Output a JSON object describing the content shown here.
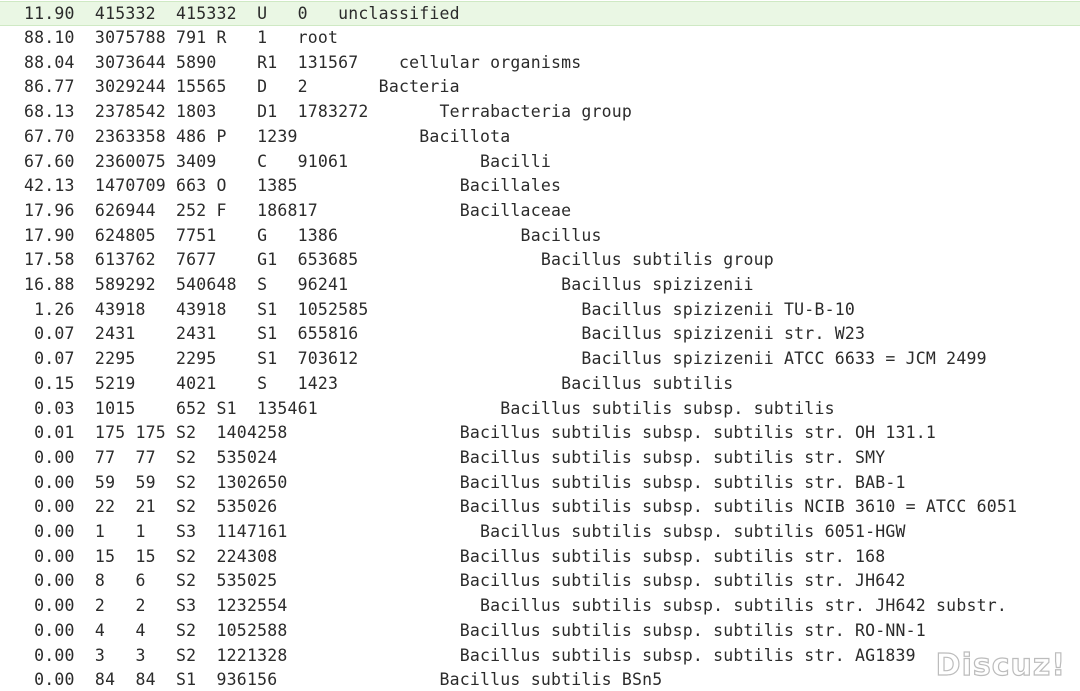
{
  "editor": {
    "lines": [
      "11.90  415332  415332  U   0   unclassified",
      "88.10  3075788 791 R   1   root",
      "88.04  3073644 5890    R1  131567    cellular organisms",
      "86.77  3029244 15565   D   2       Bacteria",
      "68.13  2378542 1803    D1  1783272       Terrabacteria group",
      "67.70  2363358 486 P   1239            Bacillota",
      "67.60  2360075 3409    C   91061             Bacilli",
      "42.13  1470709 663 O   1385                Bacillales",
      "17.96  626944  252 F   186817              Bacillaceae",
      "17.90  624805  7751    G   1386                  Bacillus",
      "17.58  613762  7677    G1  653685                  Bacillus subtilis group",
      "16.88  589292  540648  S   96241                     Bacillus spizizenii",
      " 1.26  43918   43918   S1  1052585                     Bacillus spizizenii TU-B-10",
      " 0.07  2431    2431    S1  655816                      Bacillus spizizenii str. W23",
      " 0.07  2295    2295    S1  703612                      Bacillus spizizenii ATCC 6633 = JCM 2499",
      " 0.15  5219    4021    S   1423                      Bacillus subtilis",
      " 0.03  1015    652 S1  135461                  Bacillus subtilis subsp. subtilis",
      " 0.01  175 175 S2  1404258                 Bacillus subtilis subsp. subtilis str. OH 131.1",
      " 0.00  77  77  S2  535024                  Bacillus subtilis subsp. subtilis str. SMY",
      " 0.00  59  59  S2  1302650                 Bacillus subtilis subsp. subtilis str. BAB-1",
      " 0.00  22  21  S2  535026                  Bacillus subtilis subsp. subtilis NCIB 3610 = ATCC 6051",
      " 0.00  1   1   S3  1147161                   Bacillus subtilis subsp. subtilis 6051-HGW",
      " 0.00  15  15  S2  224308                  Bacillus subtilis subsp. subtilis str. 168",
      " 0.00  8   6   S2  535025                  Bacillus subtilis subsp. subtilis str. JH642",
      " 0.00  2   2   S3  1232554                   Bacillus subtilis subsp. subtilis str. JH642 substr.",
      " 0.00  4   4   S2  1052588                 Bacillus subtilis subsp. subtilis str. RO-NN-1",
      " 0.00  3   3   S2  1221328                 Bacillus subtilis subsp. subtilis str. AG1839",
      " 0.00  84  84  S1  936156                Bacillus subtilis BSn5"
    ]
  },
  "watermark": "Discuz!",
  "colors": {
    "current_line_bg": "#eaf7e4",
    "text": "#2b2b2b",
    "background": "#ffffff"
  }
}
